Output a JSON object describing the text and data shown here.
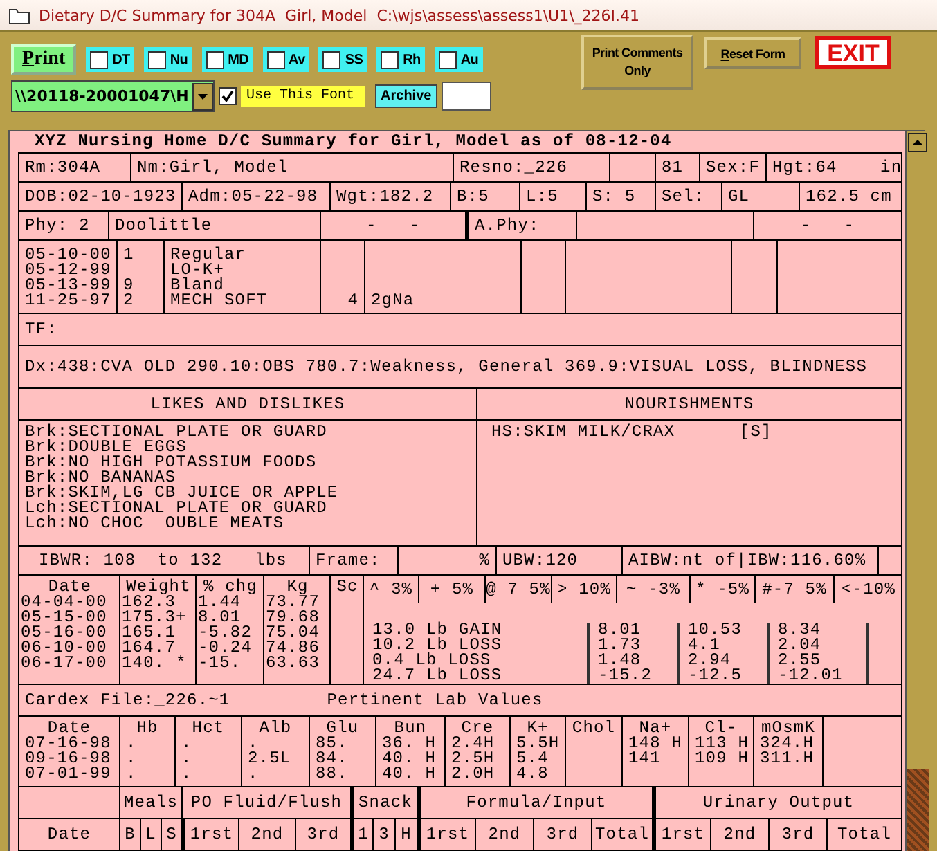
{
  "window": {
    "title": "Dietary D/C Summary for 304A  Girl, Model  C:\\wjs\\assess\\assess1\\U1\\_226I.41"
  },
  "toolbar": {
    "print_button": "Print",
    "filters": [
      {
        "label": "DT",
        "checked": false
      },
      {
        "label": "Nu",
        "checked": false
      },
      {
        "label": "MD",
        "checked": false
      },
      {
        "label": "Av",
        "checked": false
      },
      {
        "label": "SS",
        "checked": false
      },
      {
        "label": "Rh",
        "checked": false
      },
      {
        "label": "Au",
        "checked": false
      }
    ],
    "font_path": "\\\\20118-20001047\\H",
    "use_font": {
      "label": "Use This Font",
      "checked": true
    },
    "archive_button": "Archive",
    "print_comments_button": "Print Comments Only",
    "reset_button": "Reset Form",
    "exit_button": "EXIT"
  },
  "summary": {
    "heading": "XYZ Nursing Home D/C Summary for Girl, Model as of 08-12-04",
    "resident_row": [
      "Rm:304A",
      "Nm:Girl, Model",
      "Resno:_226",
      "81",
      "Sex:F",
      "Hgt:64    in"
    ],
    "stats_row": [
      "DOB:02-10-1923",
      "Adm:05-22-98",
      "Wgt:182.2",
      "B:5",
      "L:5",
      "S: 5",
      "Sel:",
      "GL",
      "162.5 cm"
    ],
    "physician_row": [
      "Phy: 2",
      "Doolittle",
      "-   -",
      "A.Phy:",
      "-   -"
    ],
    "diet_orders": [
      {
        "date": "05-10-00",
        "code": "1",
        "diet": "Regular"
      },
      {
        "date": "05-12-99",
        "diet": "LO-K+"
      },
      {
        "date": "05-13-99",
        "code": "9",
        "diet": "Bland"
      },
      {
        "date": "11-25-97",
        "code": "2",
        "diet": "MECH SOFT",
        "qty": "4",
        "note": "2gNa"
      }
    ],
    "tf": "TF:",
    "dx": "Dx:438:CVA OLD 290.10:OBS 780.7:Weakness, General 369.9:VISUAL LOSS, BLINDNESS",
    "likes_heading": "LIKES AND DISLIKES",
    "nourishments_heading": "NOURISHMENTS",
    "likes": [
      "Brk:SECTIONAL PLATE OR GUARD",
      "Brk:DOUBLE EGGS",
      "Brk:NO HIGH POTASSIUM FOODS",
      "Brk:NO BANANAS",
      "Brk:SKIM,LG CB JUICE OR APPLE",
      "Lch:SECTIONAL PLATE OR GUARD",
      "Lch:NO CHOC  OUBLE MEATS"
    ],
    "nourishments": [
      "HS:SKIM MILK/CRAX      [S]"
    ],
    "ibw_row": [
      "IBWR: 108  to 132   lbs",
      "Frame:",
      "%",
      "UBW:120",
      "AIBW:nt of|IBW:116.60%"
    ],
    "weight_columns": [
      "Date",
      "Weight",
      "% chg",
      "Kg",
      "Sc"
    ],
    "change_columns": [
      "^ 3%",
      "+ 5%",
      "@ 7 5%",
      "> 10%",
      "~ -3%",
      "* -5%",
      "#-7 5%",
      "<-10%"
    ],
    "weights": [
      {
        "date": "04-04-00",
        "weight": "162.3",
        "pct": "1.44",
        "kg": "73.77"
      },
      {
        "date": "05-15-00",
        "weight": "175.3+",
        "pct": "8.01",
        "kg": "79.68"
      },
      {
        "date": "05-16-00",
        "weight": "165.1",
        "pct": "-5.82",
        "kg": "75.04"
      },
      {
        "date": "06-10-00",
        "weight": "164.7",
        "pct": "-0.24",
        "kg": "74.86"
      },
      {
        "date": "06-17-00",
        "weight": "140. *",
        "pct": "-15.",
        "kg": "63.63"
      }
    ],
    "changes": [
      {
        "label": "13.0 Lb GAIN",
        "values": [
          "8.01",
          "10.53",
          "8.34"
        ]
      },
      {
        "label": "10.2 Lb LOSS",
        "values": [
          "1.73",
          "4.1",
          "2.04"
        ]
      },
      {
        "label": "0.4 Lb LOSS",
        "values": [
          "1.48",
          "2.94",
          "2.55"
        ]
      },
      {
        "label": "24.7 Lb LOSS",
        "values": [
          "-15.2",
          "-12.5",
          "-12.01"
        ]
      }
    ],
    "cardex": "Cardex File:_226.~1",
    "lab_heading": "Pertinent Lab Values",
    "lab_columns": [
      "Date",
      "Hb",
      "Hct",
      "Alb",
      "Glu",
      "Bun",
      "Cre",
      "K+",
      "Chol",
      "Na+",
      "Cl-",
      "mOsmK"
    ],
    "labs": [
      {
        "date": "07-16-98",
        "hb": ".",
        "hct": ".",
        "alb": ".",
        "glu": "85.",
        "bun": "36. H",
        "cre": "2.4H",
        "k": "5.5H",
        "na": "148 H",
        "cl": "113 H",
        "mosmk": "324.H"
      },
      {
        "date": "09-16-98",
        "hb": ".",
        "hct": ".",
        "alb": "2.5L",
        "glu": "84.",
        "bun": "40. H",
        "cre": "2.5H",
        "k": "5.4",
        "na": "141",
        "cl": "109 H",
        "mosmk": "311.H"
      },
      {
        "date": "07-01-99",
        "hb": ".",
        "hct": ".",
        "alb": ".",
        "glu": "88.",
        "bun": "40. H",
        "cre": "2.0H",
        "k": "4.8"
      }
    ],
    "intake_groups": [
      "Meals",
      "PO Fluid/Flush",
      "Snack",
      "Formula/Input",
      "Urinary Output"
    ],
    "intake_columns": [
      "Date",
      "B",
      "L",
      "S",
      "1rst",
      "2nd",
      "3rd",
      "1",
      "3",
      "H",
      "1rst",
      "2nd",
      "3rd",
      "Total",
      "1rst",
      "2nd",
      "3rd",
      "Total"
    ]
  }
}
